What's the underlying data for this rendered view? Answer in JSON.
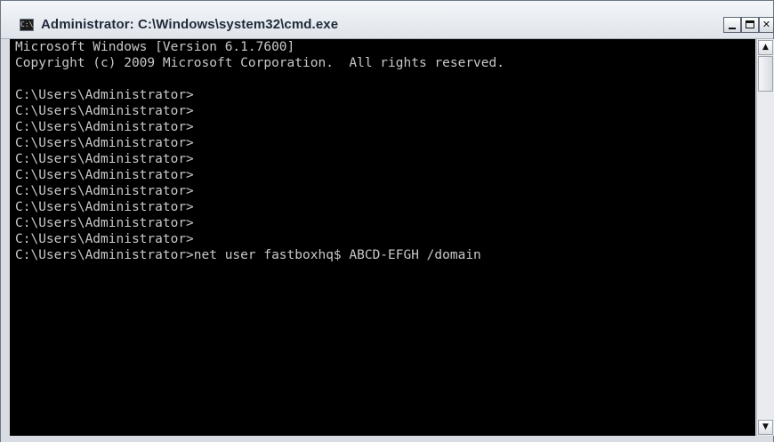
{
  "window": {
    "title": "Administrator: C:\\Windows\\system32\\cmd.exe",
    "app_icon_text": "C:\\",
    "controls": {
      "minimize": "",
      "maximize": "",
      "close": "✕"
    }
  },
  "console": {
    "foreground": "#c8c8c8",
    "background": "#000000",
    "lines": [
      "Microsoft Windows [Version 6.1.7600]",
      "Copyright (c) 2009 Microsoft Corporation.  All rights reserved.",
      "",
      "C:\\Users\\Administrator>",
      "C:\\Users\\Administrator>",
      "C:\\Users\\Administrator>",
      "C:\\Users\\Administrator>",
      "C:\\Users\\Administrator>",
      "C:\\Users\\Administrator>",
      "C:\\Users\\Administrator>",
      "C:\\Users\\Administrator>",
      "C:\\Users\\Administrator>",
      "C:\\Users\\Administrator>",
      "C:\\Users\\Administrator>net user fastboxhq$ ABCD-EFGH /domain"
    ]
  },
  "scrollbar": {
    "up_arrow": "▲",
    "down_arrow": "▼"
  }
}
